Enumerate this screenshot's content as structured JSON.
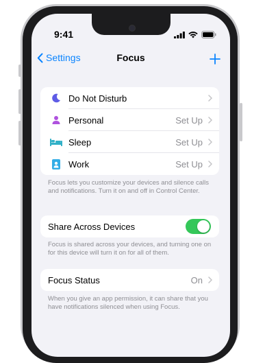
{
  "status_bar": {
    "time": "9:41"
  },
  "nav": {
    "back_label": "Settings",
    "title": "Focus"
  },
  "focus_modes": [
    {
      "label": "Do Not Disturb",
      "value": "",
      "icon": "moon-icon",
      "color": "#5e5ce6"
    },
    {
      "label": "Personal",
      "value": "Set Up",
      "icon": "person-icon",
      "color": "#af52de"
    },
    {
      "label": "Sleep",
      "value": "Set Up",
      "icon": "bed-icon",
      "color": "#30b0c7"
    },
    {
      "label": "Work",
      "value": "Set Up",
      "icon": "id-badge-icon",
      "color": "#32ade6"
    }
  ],
  "focus_footnote": "Focus lets you customize your devices and silence calls and notifications. Turn it on and off in Control Center.",
  "share": {
    "label": "Share Across Devices",
    "enabled": true,
    "footnote": "Focus is shared across your devices, and turning one on for this device will turn it on for all of them."
  },
  "status": {
    "label": "Focus Status",
    "value": "On",
    "footnote": "When you give an app permission, it can share that you have notifications silenced when using Focus."
  },
  "colors": {
    "accent": "#0a84ff",
    "toggle_on": "#34c759"
  }
}
